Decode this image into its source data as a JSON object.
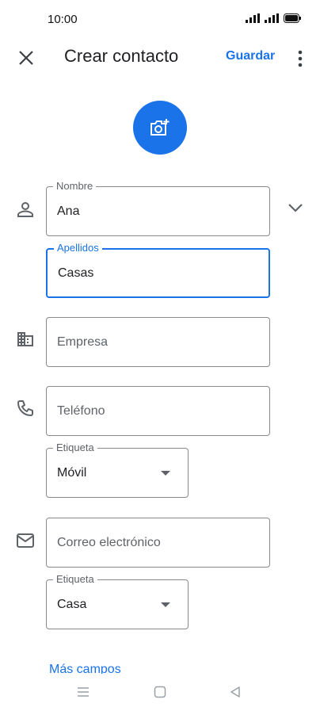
{
  "status_bar": {
    "time": "10:00"
  },
  "appbar": {
    "title": "Crear contacto",
    "save_label": "Guardar"
  },
  "form": {
    "nombre": {
      "label": "Nombre",
      "value": "Ana"
    },
    "apellidos": {
      "label": "Apellidos",
      "value": "Casas"
    },
    "empresa": {
      "placeholder": "Empresa"
    },
    "telefono": {
      "placeholder": "Teléfono"
    },
    "telefono_etiqueta": {
      "label": "Etiqueta",
      "value": "Móvil"
    },
    "correo": {
      "placeholder": "Correo electrónico"
    },
    "correo_etiqueta": {
      "label": "Etiqueta",
      "value": "Casa"
    },
    "more_fields": "Más campos"
  },
  "colors": {
    "accent": "#1a73e8",
    "text": "#202124",
    "muted": "#5f6368"
  },
  "icons": {
    "close": "close-icon",
    "more": "more-vert-icon",
    "photo": "add-photo-icon",
    "person": "person-icon",
    "expand": "chevron-down-icon",
    "business": "business-icon",
    "phone": "phone-icon",
    "email": "email-icon"
  }
}
